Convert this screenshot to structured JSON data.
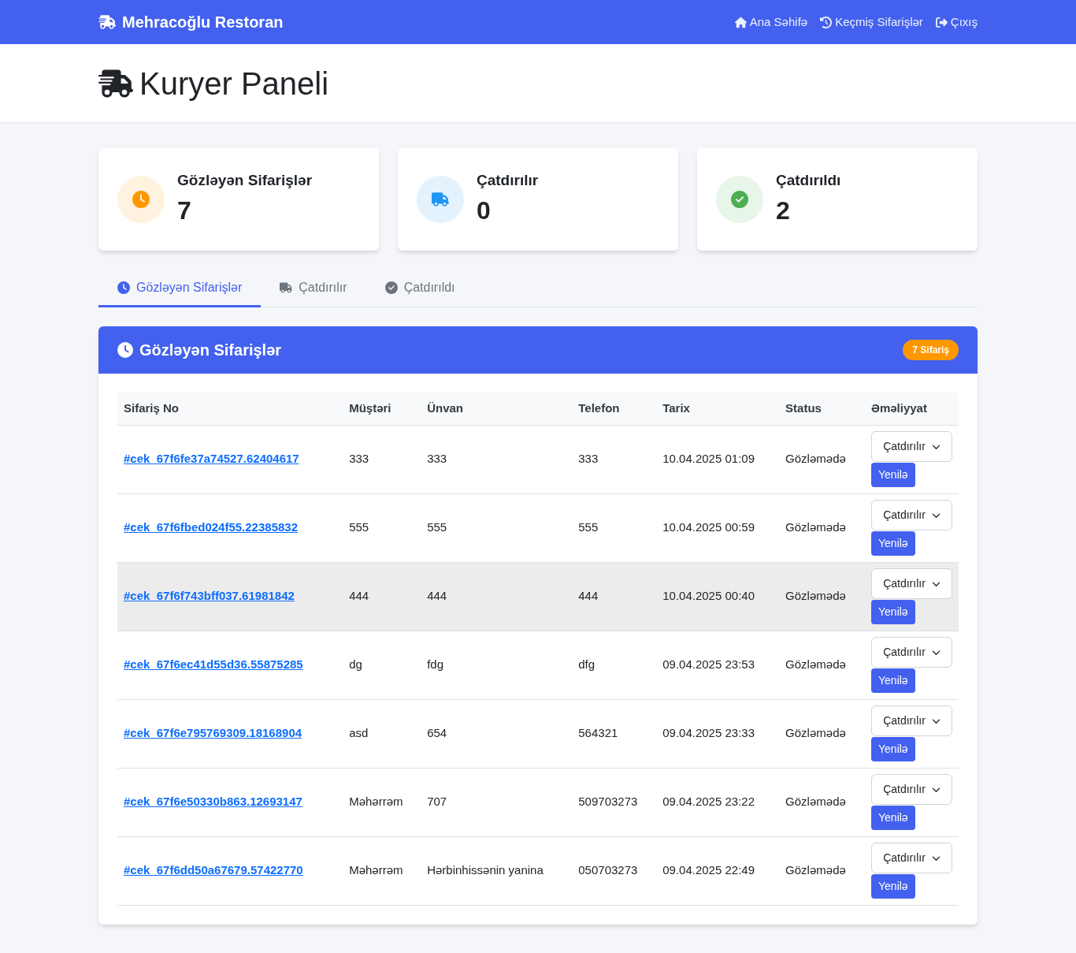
{
  "navbar": {
    "brand": "Mehracoğlu Restoran",
    "links": [
      {
        "kind": "home",
        "label": "Ana Səhifə"
      },
      {
        "kind": "history",
        "label": "Keçmiş Sifarişlər"
      },
      {
        "kind": "logout",
        "label": "Çıxış"
      }
    ]
  },
  "header": {
    "title": "Kuryer Paneli"
  },
  "stats": [
    {
      "kind": "pending",
      "label": "Gözləyən Sifarişlər",
      "value": "7"
    },
    {
      "kind": "delivering",
      "label": "Çatdırılır",
      "value": "0"
    },
    {
      "kind": "delivered",
      "label": "Çatdırıldı",
      "value": "2"
    }
  ],
  "tabs": [
    {
      "kind": "pending",
      "label": "Gözləyən Sifarişlər",
      "selected": true
    },
    {
      "kind": "delivering",
      "label": "Çatdırılır",
      "selected": false
    },
    {
      "kind": "delivered",
      "label": "Çatdırıldı",
      "selected": false
    }
  ],
  "panel": {
    "title": "Gözləyən Sifarişlər",
    "badge": "7 Sifariş",
    "columns": [
      "Sifariş No",
      "Müştəri",
      "Ünvan",
      "Telefon",
      "Tarix",
      "Status",
      "Əməliyyat"
    ],
    "rows": [
      {
        "order": "#cek_67f6fe37a74527.62404617",
        "customer": "333",
        "address": "333",
        "phone": "333",
        "date": "10.04.2025 01:09",
        "status": "Gözləmədə",
        "select": "Çatdırılır",
        "button": "Yenilə",
        "hovered": false
      },
      {
        "order": "#cek_67f6fbed024f55.22385832",
        "customer": "555",
        "address": "555",
        "phone": "555",
        "date": "10.04.2025 00:59",
        "status": "Gözləmədə",
        "select": "Çatdırılır",
        "button": "Yenilə",
        "hovered": false
      },
      {
        "order": "#cek_67f6f743bff037.61981842",
        "customer": "444",
        "address": "444",
        "phone": "444",
        "date": "10.04.2025 00:40",
        "status": "Gözləmədə",
        "select": "Çatdırılır",
        "button": "Yenilə",
        "hovered": true
      },
      {
        "order": "#cek_67f6ec41d55d36.55875285",
        "customer": "dg",
        "address": "fdg",
        "phone": "dfg",
        "date": "09.04.2025 23:53",
        "status": "Gözləmədə",
        "select": "Çatdırılır",
        "button": "Yenilə",
        "hovered": false
      },
      {
        "order": "#cek_67f6e795769309.18168904",
        "customer": "asd",
        "address": "654",
        "phone": "564321",
        "date": "09.04.2025 23:33",
        "status": "Gözləmədə",
        "select": "Çatdırılır",
        "button": "Yenilə",
        "hovered": false
      },
      {
        "order": "#cek_67f6e50330b863.12693147",
        "customer": "Məhərrəm",
        "address": "707",
        "phone": "509703273",
        "date": "09.04.2025 23:22",
        "status": "Gözləmədə",
        "select": "Çatdırılır",
        "button": "Yenilə",
        "hovered": false
      },
      {
        "order": "#cek_67f6dd50a67679.57422770",
        "customer": "Məhərrəm",
        "address": "Hərbinhissənin yanina",
        "phone": "050703273",
        "date": "09.04.2025 22:49",
        "status": "Gözləmədə",
        "select": "Çatdırılır",
        "button": "Yenilə",
        "hovered": false
      }
    ]
  }
}
